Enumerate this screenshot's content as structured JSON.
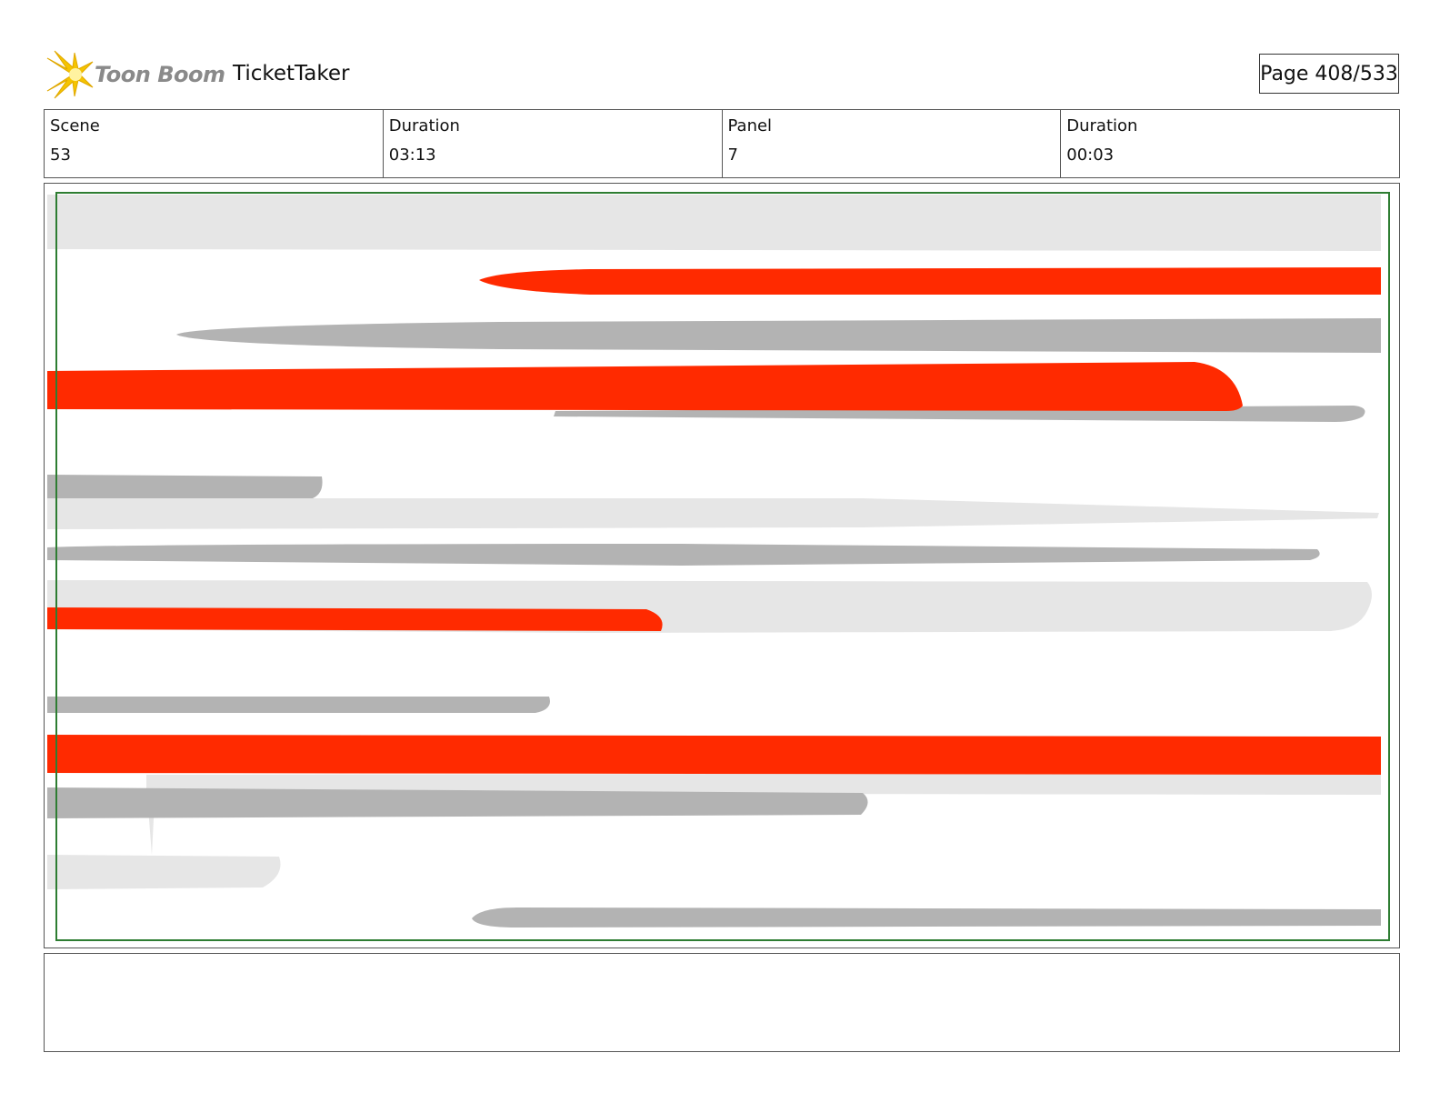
{
  "header": {
    "logo_text": "Toon Boom",
    "project_title": "TicketTaker",
    "page_number": "Page 408/533"
  },
  "info": {
    "scene_label": "Scene",
    "scene_value": "53",
    "scene_duration_label": "Duration",
    "scene_duration_value": "03:13",
    "panel_label": "Panel",
    "panel_value": "7",
    "panel_duration_label": "Duration",
    "panel_duration_value": "00:03"
  },
  "notes": {
    "text": ""
  },
  "colors": {
    "accent_red": "#ff2a00",
    "stroke_gray": "#b3b3b3",
    "stroke_light": "#e6e6e6",
    "safe_area": "#2e7d32"
  }
}
